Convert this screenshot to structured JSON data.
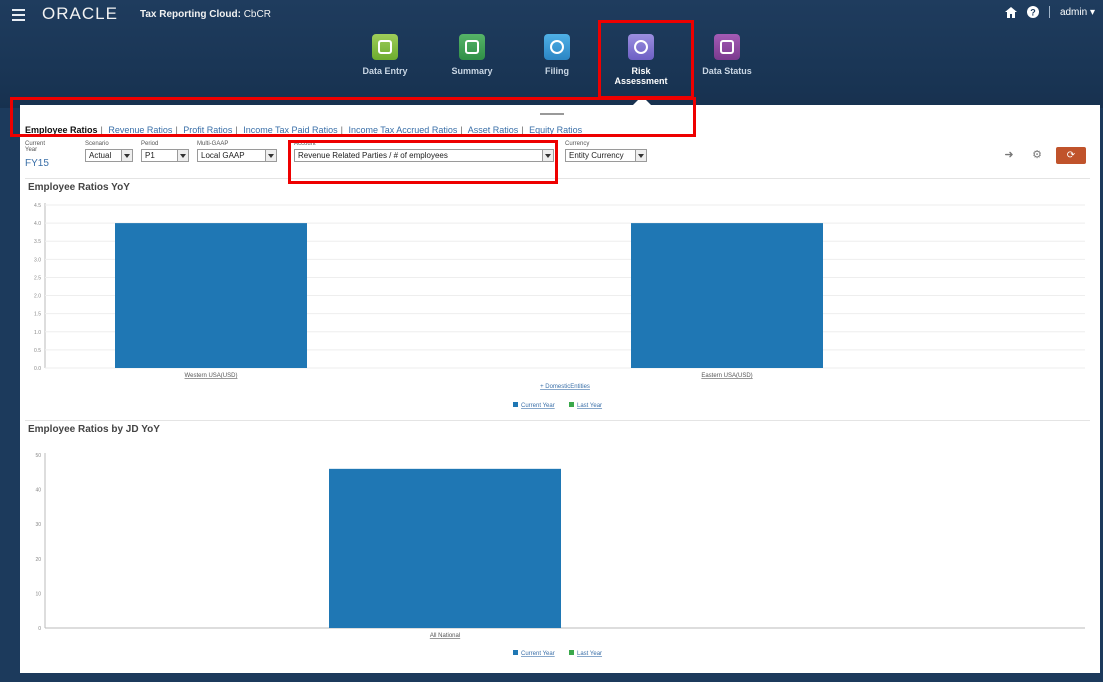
{
  "header": {
    "logo": "ORACLE",
    "app_title_prefix": "Tax Reporting Cloud:",
    "app_title_suffix": "CbCR",
    "user": "admin"
  },
  "nav": [
    {
      "label": "Data Entry",
      "icon": "data-entry-icon"
    },
    {
      "label": "Summary",
      "icon": "summary-icon"
    },
    {
      "label": "Filing",
      "icon": "filing-icon"
    },
    {
      "label": "Risk Assessment",
      "icon": "risk-assessment-icon",
      "active": true
    },
    {
      "label": "Data Status",
      "icon": "data-status-icon"
    }
  ],
  "tabs": [
    {
      "label": "Employee Ratios",
      "active": true
    },
    {
      "label": "Revenue Ratios"
    },
    {
      "label": "Profit Ratios"
    },
    {
      "label": "Income Tax Paid Ratios"
    },
    {
      "label": "Income Tax Accrued Ratios"
    },
    {
      "label": "Asset Ratios"
    },
    {
      "label": "Equity Ratios"
    }
  ],
  "pov": {
    "current_year": {
      "label": "Current Year",
      "value": "FY15"
    },
    "scenario": {
      "label": "Scenario",
      "value": "Actual"
    },
    "period": {
      "label": "Period",
      "value": "P1"
    },
    "multi_gaap": {
      "label": "Multi-GAAP",
      "value": "Local GAAP"
    },
    "account": {
      "label": "Account",
      "value": "Revenue Related Parties / # of employees"
    },
    "currency": {
      "label": "Currency",
      "value": "Entity Currency"
    }
  },
  "chart_data": [
    {
      "type": "bar",
      "title": "Employee Ratios YoY",
      "categories": [
        "Western USA(USD)",
        "Eastern USA(USD)"
      ],
      "series": [
        {
          "name": "Current Year",
          "values": [
            4.0,
            4.0
          ],
          "color": "#1f77b4"
        },
        {
          "name": "Last Year",
          "values": [
            0,
            0
          ],
          "color": "#3aa84b"
        }
      ],
      "ylim": [
        0,
        4.5
      ],
      "yticks": [
        "4.5",
        "4.0",
        "3.5",
        "3.0",
        "2.5",
        "2.0",
        "1.5",
        "1.0",
        "0.5",
        "0.0"
      ],
      "xlabel": "DomesticEntities",
      "legend": "bottom-center",
      "grid": true
    },
    {
      "type": "bar",
      "title": "Employee Ratios by JD YoY",
      "categories": [
        "All National"
      ],
      "series": [
        {
          "name": "Current Year",
          "values": [
            46
          ],
          "color": "#1f77b4"
        },
        {
          "name": "Last Year",
          "values": [
            0
          ],
          "color": "#3aa84b"
        }
      ],
      "ylim": [
        0,
        50
      ],
      "yticks": [
        "50",
        "40",
        "30",
        "20",
        "10",
        "0"
      ],
      "legend": "bottom-center",
      "grid": false
    }
  ]
}
